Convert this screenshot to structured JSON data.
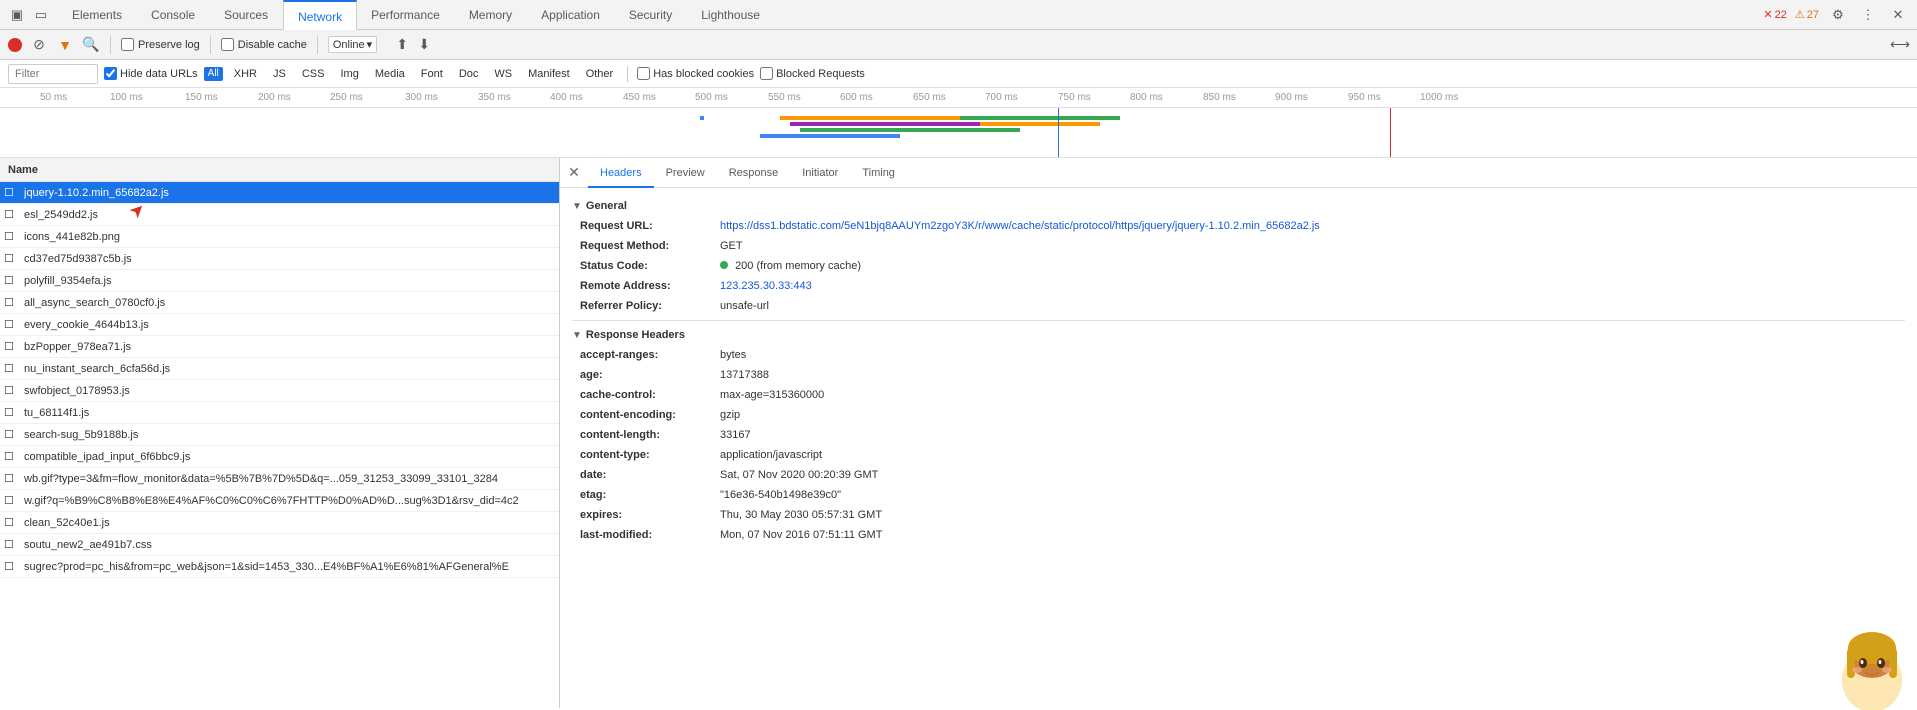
{
  "tabs": {
    "items": [
      {
        "label": "Elements",
        "active": false
      },
      {
        "label": "Console",
        "active": false
      },
      {
        "label": "Sources",
        "active": false
      },
      {
        "label": "Network",
        "active": true
      },
      {
        "label": "Performance",
        "active": false
      },
      {
        "label": "Memory",
        "active": false
      },
      {
        "label": "Application",
        "active": false
      },
      {
        "label": "Security",
        "active": false
      },
      {
        "label": "Lighthouse",
        "active": false
      }
    ],
    "badge_error": "22",
    "badge_warn": "27"
  },
  "toolbar": {
    "preserve_log": "Preserve log",
    "disable_cache": "Disable cache",
    "online_label": "Online"
  },
  "filter": {
    "placeholder": "Filter",
    "hide_data_urls": "Hide data URLs",
    "all_label": "All",
    "types": [
      "XHR",
      "JS",
      "CSS",
      "Img",
      "Media",
      "Font",
      "Doc",
      "WS",
      "Manifest",
      "Other"
    ],
    "has_blocked": "Has blocked cookies",
    "blocked_requests": "Blocked Requests"
  },
  "timeline": {
    "ticks": [
      "50 ms",
      "100 ms",
      "150 ms",
      "200 ms",
      "250 ms",
      "300 ms",
      "350 ms",
      "400 ms",
      "450 ms",
      "500 ms",
      "550 ms",
      "600 ms",
      "650 ms",
      "700 ms",
      "750 ms",
      "800 ms",
      "850 ms",
      "900 ms",
      "950 ms",
      "1000 ms"
    ]
  },
  "network_list": {
    "column_name": "Name",
    "rows": [
      {
        "name": "jquery-1.10.2.min_65682a2.js",
        "selected": true
      },
      {
        "name": "esl_2549dd2.js",
        "selected": false
      },
      {
        "name": "icons_441e82b.png",
        "selected": false
      },
      {
        "name": "cd37ed75d9387c5b.js",
        "selected": false
      },
      {
        "name": "polyfill_9354efa.js",
        "selected": false
      },
      {
        "name": "all_async_search_0780cf0.js",
        "selected": false
      },
      {
        "name": "every_cookie_4644b13.js",
        "selected": false
      },
      {
        "name": "bzPopper_978ea71.js",
        "selected": false
      },
      {
        "name": "nu_instant_search_6cfa56d.js",
        "selected": false
      },
      {
        "name": "swfobject_0178953.js",
        "selected": false
      },
      {
        "name": "tu_68114f1.js",
        "selected": false
      },
      {
        "name": "search-sug_5b9188b.js",
        "selected": false
      },
      {
        "name": "compatible_ipad_input_6f6bbc9.js",
        "selected": false
      },
      {
        "name": "wb.gif?type=3&fm=flow_monitor&data=%5B%7B%7D%5D&q=...059_31253_33099_33101_3284",
        "selected": false
      },
      {
        "name": "w.gif?q=%B9%C8%B8%E8%E4%AF%C0%C0%C6%7FHTTP%D0%AD%D...sug%3D1&rsv_did=4c2",
        "selected": false
      },
      {
        "name": "clean_52c40e1.js",
        "selected": false
      },
      {
        "name": "soutu_new2_ae491b7.css",
        "selected": false
      },
      {
        "name": "sugrec?prod=pc_his&from=pc_web&json=1&sid=1453_330...E4%BF%A1%E6%81%AFGeneral%E",
        "selected": false
      }
    ]
  },
  "headers_panel": {
    "tabs": [
      "Headers",
      "Preview",
      "Response",
      "Initiator",
      "Timing"
    ],
    "active_tab": "Headers",
    "general": {
      "title": "General",
      "request_url_key": "Request URL:",
      "request_url_val": "https://dss1.bdstatic.com/5eN1bjq8AAUYm2zgoY3K/r/www/cache/static/protocol/https/jquery/jquery-1.10.2.min_65682a2.js",
      "request_method_key": "Request Method:",
      "request_method_val": "GET",
      "status_code_key": "Status Code:",
      "status_code_val": "200  (from memory cache)",
      "remote_address_key": "Remote Address:",
      "remote_address_val": "123.235.30.33:443",
      "referrer_policy_key": "Referrer Policy:",
      "referrer_policy_val": "unsafe-url"
    },
    "response_headers": {
      "title": "Response Headers",
      "items": [
        {
          "key": "accept-ranges:",
          "val": "bytes"
        },
        {
          "key": "age:",
          "val": "13717388"
        },
        {
          "key": "cache-control:",
          "val": "max-age=315360000"
        },
        {
          "key": "content-encoding:",
          "val": "gzip"
        },
        {
          "key": "content-length:",
          "val": "33167"
        },
        {
          "key": "content-type:",
          "val": "application/javascript"
        },
        {
          "key": "date:",
          "val": "Sat, 07 Nov 2020 00:20:39 GMT"
        },
        {
          "key": "etag:",
          "val": "\"16e36-540b1498e39c0\""
        },
        {
          "key": "expires:",
          "val": "Thu, 30 May 2030 05:57:31 GMT"
        },
        {
          "key": "last-modified:",
          "val": "Mon, 07 Nov 2016 07:51:11 GMT"
        }
      ]
    }
  }
}
